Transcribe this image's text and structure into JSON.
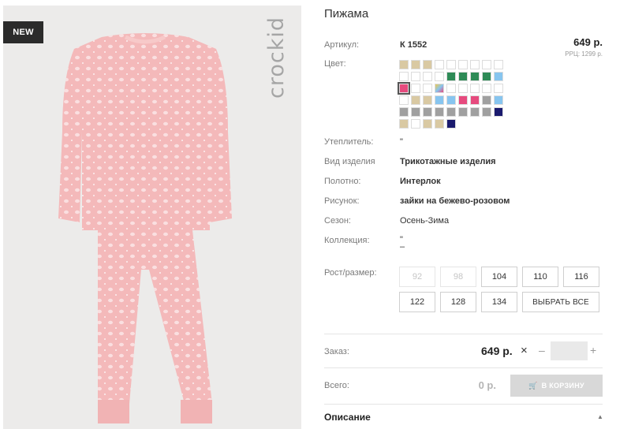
{
  "image": {
    "badge": "NEW",
    "brand": "crockid"
  },
  "product": {
    "title": "Пижама",
    "article_label": "Артикул:",
    "article_value": "К 1552",
    "price": "649 р.",
    "rrp": "РРЦ: 1299 р.",
    "color_label": "Цвет:",
    "swatches": [
      "#d9c9a3",
      "#d9c9a3",
      "#d9c9a3",
      "#ffffff",
      "#ffffff",
      "#ffffff",
      "#ffffff",
      "#ffffff",
      "#ffffff",
      "#ffffff",
      "#ffffff",
      "#ffffff",
      "#ffffff",
      "#2e8b57",
      "#2e8b57",
      "#2e8b57",
      "#2e8b57",
      "#87c5ef",
      "#e64a7e",
      "#ffffff",
      "#ffffff",
      "#multi",
      "#ffffff",
      "#ffffff",
      "#ffffff",
      "#ffffff",
      "#ffffff",
      "#ffffff",
      "#d9c9a3",
      "#d9c9a3",
      "#87c5ef",
      "#87c5ef",
      "#e64a7e",
      "#e64a7e",
      "#a0a0a0",
      "#87c5ef",
      "#a0a0a0",
      "#a0a0a0",
      "#a0a0a0",
      "#a0a0a0",
      "#a0a0a0",
      "#a0a0a0",
      "#a0a0a0",
      "#a0a0a0",
      "#1a1a6e",
      "#d9c9a3",
      "#ffffff",
      "#d9c9a3",
      "#d9c9a3",
      "#1a1a6e"
    ],
    "active_swatch_index": 18,
    "insulation_label": "Утеплитель:",
    "insulation_value": "\"",
    "type_label": "Вид изделия",
    "type_value": "Трикотажные изделия",
    "fabric_label": "Полотно:",
    "fabric_value": "Интерлок",
    "pattern_label": "Рисунок:",
    "pattern_value": "зайки на бежево-розовом",
    "season_label": "Сезон:",
    "season_value": "Осень-Зима",
    "collection_label": "Коллекция:",
    "collection_value_1": "\"",
    "collection_value_2": "–",
    "size_label": "Рост/размер:",
    "sizes": [
      {
        "label": "92",
        "available": false
      },
      {
        "label": "98",
        "available": false
      },
      {
        "label": "104",
        "available": true
      },
      {
        "label": "110",
        "available": true
      },
      {
        "label": "116",
        "available": true
      },
      {
        "label": "122",
        "available": true
      },
      {
        "label": "128",
        "available": true
      },
      {
        "label": "134",
        "available": true
      }
    ],
    "select_all": "ВЫБРАТЬ ВСЕ"
  },
  "order": {
    "label": "Заказ:",
    "price": "649 р.",
    "remove_icon": "×",
    "minus": "–",
    "plus": "+",
    "quantity": ""
  },
  "total": {
    "label": "Всего:",
    "value": "0 р.",
    "cart_button": "В КОРЗИНУ"
  },
  "description": {
    "title": "Описание",
    "caret": "▲"
  },
  "colors": {
    "garment": "#f4b9ba",
    "photo_bg": "#ecebea"
  }
}
